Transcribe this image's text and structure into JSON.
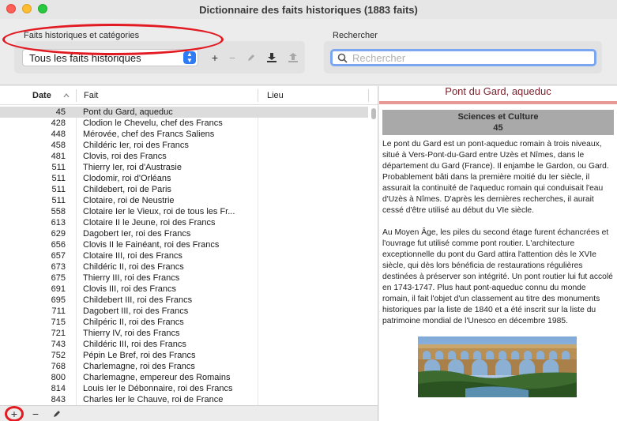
{
  "window": {
    "title": "Dictionnaire des faits historiques (1883 faits)"
  },
  "toolbar": {
    "category_group_label": "Faits historiques et catégories",
    "category_selected": "Tous les faits historiques",
    "search_group_label": "Rechercher",
    "search_placeholder": "Rechercher",
    "search_value": ""
  },
  "table": {
    "headers": {
      "date": "Date",
      "fait": "Fait",
      "lieu": "Lieu"
    },
    "rows": [
      {
        "date": "45",
        "fait": "Pont du Gard, aqueduc",
        "lieu": ""
      },
      {
        "date": "428",
        "fait": "Clodion le Chevelu, chef des Francs",
        "lieu": ""
      },
      {
        "date": "448",
        "fait": "Mérovée, chef des Francs Saliens",
        "lieu": ""
      },
      {
        "date": "458",
        "fait": "Childéric Ier, roi des Francs",
        "lieu": ""
      },
      {
        "date": "481",
        "fait": "Clovis, roi des Francs",
        "lieu": ""
      },
      {
        "date": "511",
        "fait": "Thierry Ier, roi d'Austrasie",
        "lieu": ""
      },
      {
        "date": "511",
        "fait": "Clodomir, roi d'Orléans",
        "lieu": ""
      },
      {
        "date": "511",
        "fait": "Childebert, roi de Paris",
        "lieu": ""
      },
      {
        "date": "511",
        "fait": "Clotaire, roi de Neustrie",
        "lieu": ""
      },
      {
        "date": "558",
        "fait": "Clotaire Ier le Vieux, roi de tous les Fr...",
        "lieu": ""
      },
      {
        "date": "613",
        "fait": "Clotaire II le Jeune, roi des Francs",
        "lieu": ""
      },
      {
        "date": "629",
        "fait": "Dagobert Ier, roi des Francs",
        "lieu": ""
      },
      {
        "date": "656",
        "fait": "Clovis II le Fainéant, roi des Francs",
        "lieu": ""
      },
      {
        "date": "657",
        "fait": "Clotaire III, roi des Francs",
        "lieu": ""
      },
      {
        "date": "673",
        "fait": "Childéric II, roi des Francs",
        "lieu": ""
      },
      {
        "date": "675",
        "fait": "Thierry III, roi des Francs",
        "lieu": ""
      },
      {
        "date": "691",
        "fait": "Clovis III, roi des Francs",
        "lieu": ""
      },
      {
        "date": "695",
        "fait": "Childebert III, roi des Francs",
        "lieu": ""
      },
      {
        "date": "711",
        "fait": "Dagobert III, roi des Francs",
        "lieu": ""
      },
      {
        "date": "715",
        "fait": "Chilpéric II, roi des Francs",
        "lieu": ""
      },
      {
        "date": "721",
        "fait": "Thierry IV, roi des Francs",
        "lieu": ""
      },
      {
        "date": "743",
        "fait": "Childéric III, roi des Francs",
        "lieu": ""
      },
      {
        "date": "752",
        "fait": "Pépin Le Bref, roi des Francs",
        "lieu": ""
      },
      {
        "date": "768",
        "fait": "Charlemagne, roi des Francs",
        "lieu": ""
      },
      {
        "date": "800",
        "fait": "Charlemagne, empereur des Romains",
        "lieu": ""
      },
      {
        "date": "814",
        "fait": "Louis Ier le Débonnaire, roi des Francs",
        "lieu": ""
      },
      {
        "date": "843",
        "fait": "Charles Ier le Chauve, roi de France",
        "lieu": ""
      }
    ],
    "selected_index": 0
  },
  "detail": {
    "title": "Pont du Gard, aqueduc",
    "category": "Sciences et Culture",
    "year": "45",
    "paragraphs": [
      "Le pont du Gard est un pont-aqueduc romain à trois niveaux, situé à Vers-Pont-du-Gard entre Uzès et Nîmes, dans le département du Gard (France). Il enjambe le Gardon, ou Gard. Probablement bâti dans la première moitié du Ier siècle, il assurait la continuité de l'aqueduc romain qui conduisait l'eau d'Uzès à Nîmes. D'après les dernières recherches, il aurait cessé d'être utilisé au début du VIe siècle.",
      "Au Moyen Âge, les piles du second étage furent échancrées et l'ouvrage fut utilisé comme pont routier. L'architecture exceptionnelle du pont du Gard attira l'attention dès le XVIe siècle, qui dès lors bénéficia de restaurations régulières destinées à préserver son intégrité. Un pont routier lui fut accolé en 1743-1747. Plus haut pont-aqueduc connu du monde romain, il fait l'objet d'un classement au titre des monuments historiques par la liste de 1840 et a été inscrit sur la liste du patrimoine mondial de l'Unesco en décembre 1985."
    ]
  },
  "colors": {
    "accent": "#2f7bf5",
    "annotation": "#e21b23",
    "detail_title": "#7a1f2a",
    "detail_rule": "#e79a95",
    "category_box": "#a9a9a9",
    "selected_row": "#dcdcdc"
  },
  "icons": {
    "popup": "chevron-updown-icon",
    "add": "plus-icon",
    "remove": "minus-icon",
    "edit": "pencil-icon",
    "import": "download-icon",
    "export": "upload-icon",
    "search": "magnifier-icon",
    "sort": "sort-ascending-icon"
  }
}
